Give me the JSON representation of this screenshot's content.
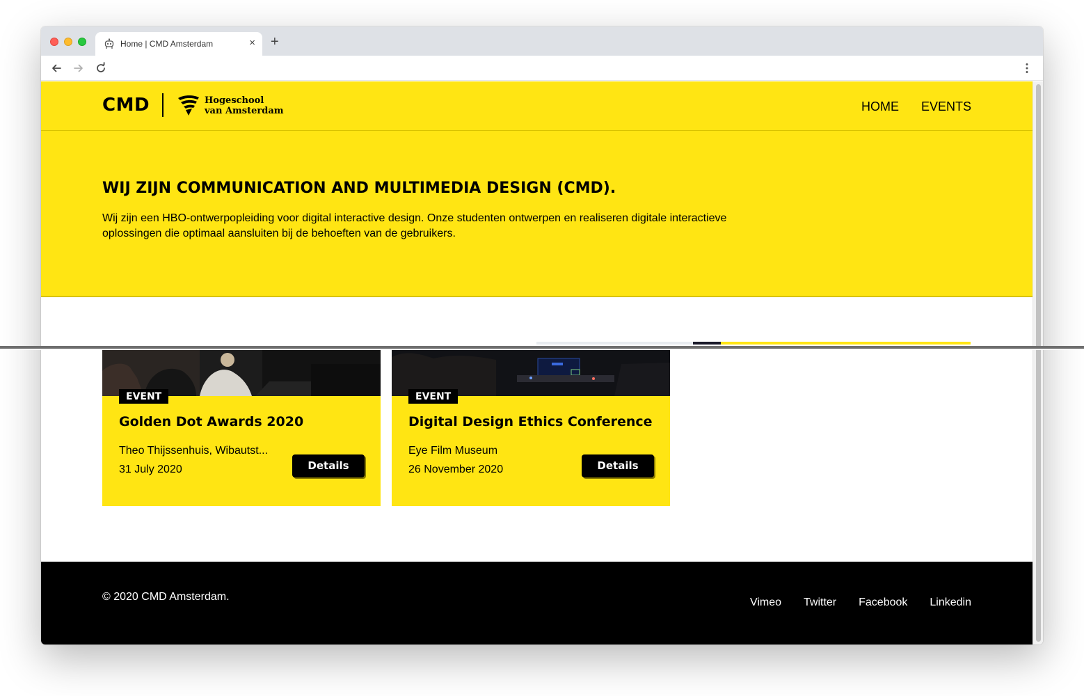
{
  "browser": {
    "tab_title": "Home | CMD Amsterdam",
    "close_label": "×",
    "new_tab_label": "+"
  },
  "header": {
    "brand": "CMD",
    "partner_line1": "Hogeschool",
    "partner_line2": "van Amsterdam",
    "nav": [
      {
        "label": "HOME"
      },
      {
        "label": "EVENTS"
      }
    ]
  },
  "hero": {
    "title": "WIJ ZIJN COMMUNICATION AND MULTIMEDIA DESIGN (CMD).",
    "text": "Wij zijn een HBO-ontwerpopleiding voor digital interactive design. Onze studenten ontwerpen en realiseren digitale interactieve oplossingen die optimaal aansluiten bij de behoeften van de gebruikers."
  },
  "events": [
    {
      "tag": "EVENT",
      "title": "Golden Dot Awards 2020",
      "venue": "Theo Thijssenhuis, Wibautst...",
      "date": "31 July 2020",
      "button": "Details"
    },
    {
      "tag": "EVENT",
      "title": "Digital Design Ethics Conference",
      "venue": "Eye Film Museum",
      "date": "26 November 2020",
      "button": "Details"
    }
  ],
  "footer": {
    "copyright": "© 2020 CMD Amsterdam.",
    "links": [
      {
        "label": "Vimeo"
      },
      {
        "label": "Twitter"
      },
      {
        "label": "Facebook"
      },
      {
        "label": "Linkedin"
      }
    ]
  },
  "colors": {
    "brand_yellow": "#ffe513",
    "black": "#000000",
    "white": "#ffffff"
  },
  "icons": [
    "robot-favicon-icon",
    "back-arrow-icon",
    "forward-arrow-icon",
    "reload-icon",
    "more-vertical-icon",
    "hva-logo-icon"
  ]
}
